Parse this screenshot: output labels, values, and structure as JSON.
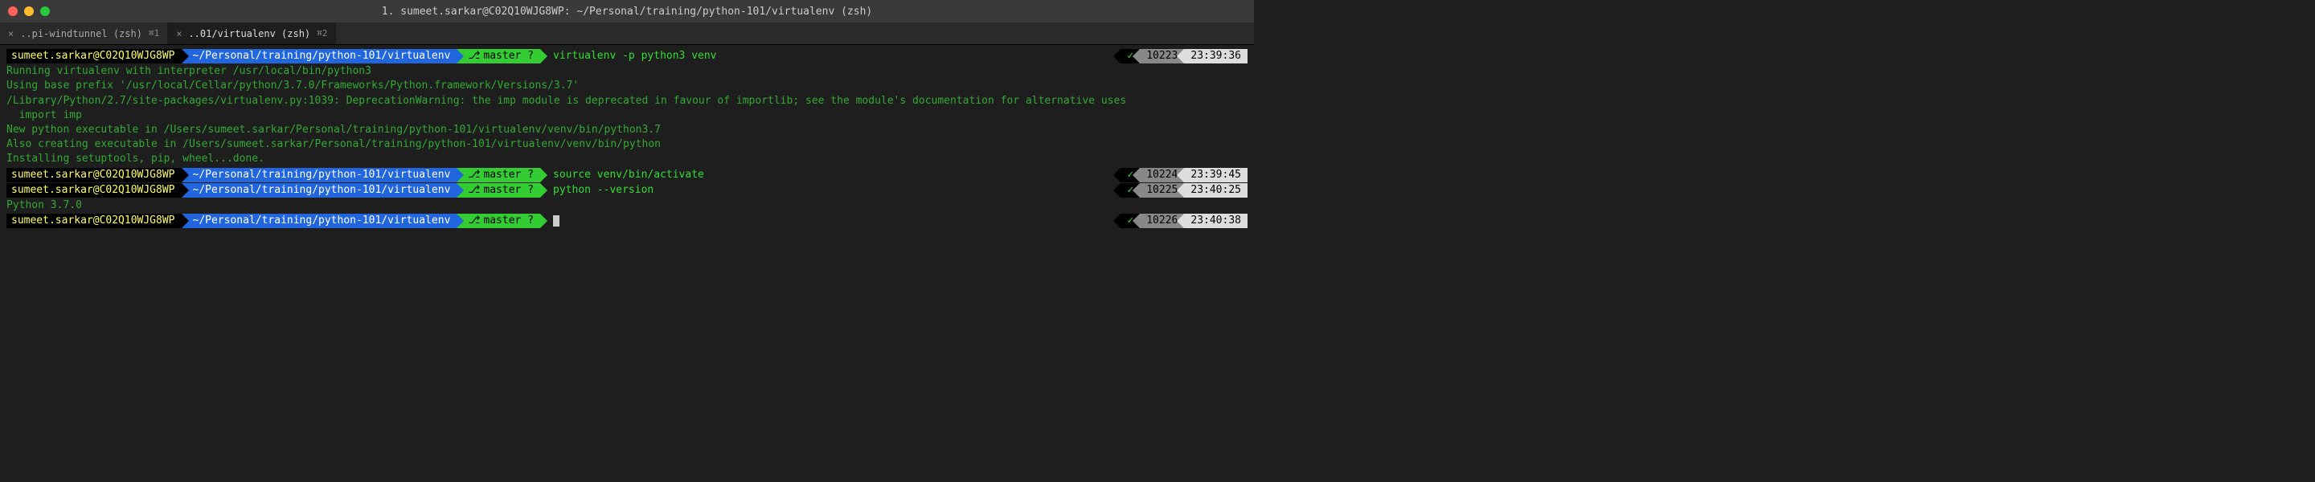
{
  "window": {
    "title": "1. sumeet.sarkar@C02Q10WJG8WP: ~/Personal/training/python-101/virtualenv (zsh)"
  },
  "tabs": [
    {
      "close": "×",
      "label": "..pi-windtunnel (zsh)",
      "shortcut": "⌘1"
    },
    {
      "close": "×",
      "label": "..01/virtualenv (zsh)",
      "shortcut": "⌘2"
    }
  ],
  "prompt": {
    "user": "sumeet.sarkar@C02Q10WJG8WP",
    "path": "~/Personal/training/python-101/virtualenv",
    "branch": "master ?",
    "branch_icon": "⎇"
  },
  "entries": [
    {
      "cmd": "virtualenv -p python3 venv",
      "status": {
        "check": "✓",
        "num": "10223",
        "time": "23:39:36"
      },
      "output": [
        "Running virtualenv with interpreter /usr/local/bin/python3",
        "Using base prefix '/usr/local/Cellar/python/3.7.0/Frameworks/Python.framework/Versions/3.7'",
        "/Library/Python/2.7/site-packages/virtualenv.py:1039: DeprecationWarning: the imp module is deprecated in favour of importlib; see the module's documentation for alternative uses",
        "  import imp",
        "New python executable in /Users/sumeet.sarkar/Personal/training/python-101/virtualenv/venv/bin/python3.7",
        "Also creating executable in /Users/sumeet.sarkar/Personal/training/python-101/virtualenv/venv/bin/python",
        "Installing setuptools, pip, wheel...done."
      ]
    },
    {
      "cmd": "source venv/bin/activate",
      "status": {
        "check": "✓",
        "num": "10224",
        "time": "23:39:45"
      },
      "output": []
    },
    {
      "cmd": "python --version",
      "status": {
        "check": "✓",
        "num": "10225",
        "time": "23:40:25"
      },
      "output": [
        "Python 3.7.0"
      ]
    },
    {
      "cmd": "",
      "status": {
        "check": "✓",
        "num": "10226",
        "time": "23:40:38"
      },
      "output": []
    }
  ]
}
